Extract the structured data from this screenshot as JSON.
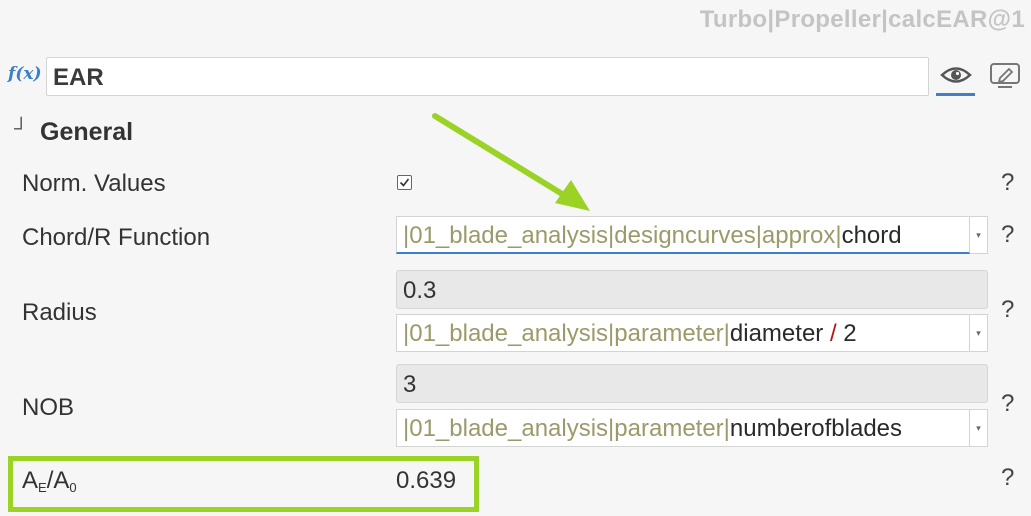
{
  "header": {
    "path": "Turbo|Propeller|calcEAR@1"
  },
  "formula": {
    "fx_label": "f(x)",
    "name": "EAR"
  },
  "section": {
    "toggle": "┘",
    "title": "General"
  },
  "help_symbol": "?",
  "rows": {
    "norm_values": {
      "label": "Norm. Values",
      "checked": true
    },
    "chord": {
      "label": "Chord/R Function",
      "ref_path": "|01_blade_analysis|designcurves|approx|",
      "ref_term": "chord"
    },
    "radius": {
      "label": "Radius",
      "value": "0.3",
      "ref_path": "|01_blade_analysis|parameter|",
      "ref_term": "diameter",
      "ref_op": "/",
      "ref_num": "2"
    },
    "nob": {
      "label": "NOB",
      "value": "3",
      "ref_path": "|01_blade_analysis|parameter|",
      "ref_term": "numberofblades"
    },
    "ear": {
      "label_main": "A",
      "label_sub1": "E",
      "label_mid": "/A",
      "label_sub2": "0",
      "value": "0.639"
    }
  },
  "colors": {
    "accent": "#3d7fc9",
    "highlight": "#9ad225",
    "ref_path": "#9c9a6a",
    "operator": "#b01818"
  },
  "icons": {
    "view": "eye-icon",
    "edit": "edit-icon",
    "dropdown": "chevron-down-icon"
  }
}
